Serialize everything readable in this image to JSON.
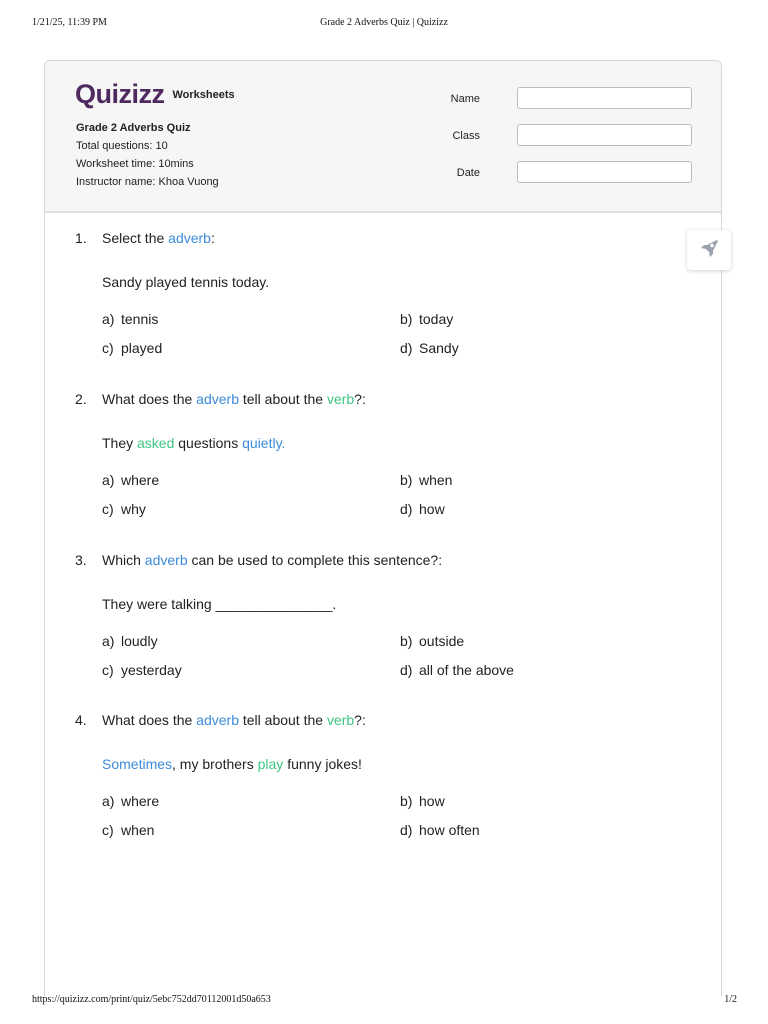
{
  "print_header": {
    "datetime": "1/21/25, 11:39 PM",
    "page_title": "Grade 2 Adverbs Quiz | Quizizz"
  },
  "print_footer": {
    "url": "https://quizizz.com/print/quiz/5ebc752dd70112001d50a653",
    "page": "1/2"
  },
  "brand": {
    "logo": "Quizizz",
    "section": "Worksheets"
  },
  "worksheet": {
    "title": "Grade 2 Adverbs Quiz",
    "total_questions": "Total questions: 10",
    "time": "Worksheet time: 10mins",
    "instructor": "Instructor name: Khoa Vuong"
  },
  "fields": [
    {
      "label": "Name",
      "value": ""
    },
    {
      "label": "Class",
      "value": ""
    },
    {
      "label": "Date",
      "value": ""
    }
  ],
  "fab": {
    "icon": "rocket-icon"
  },
  "colors": {
    "adverb": "#3d8bd9",
    "verb": "#3fc583",
    "brand": "#4e2a5f"
  },
  "questions": [
    {
      "number": "1.",
      "prompt": {
        "p1": "Select the ",
        "adverb": "adverb",
        "p2": ":"
      },
      "sentence": {
        "text": "Sandy played tennis today."
      },
      "options": [
        {
          "letter": "a)",
          "text": "tennis"
        },
        {
          "letter": "b)",
          "text": "today"
        },
        {
          "letter": "c)",
          "text": "played"
        },
        {
          "letter": "d)",
          "text": "Sandy"
        }
      ]
    },
    {
      "number": "2.",
      "prompt": {
        "p1": "What does the ",
        "adverb": "adverb",
        "p2": " tell about the ",
        "verb": "verb",
        "p3": "?:"
      },
      "sentence": {
        "s1": "They ",
        "verb": "asked",
        "s2": " questions ",
        "adverb": "quietly."
      },
      "options": [
        {
          "letter": "a)",
          "text": "where"
        },
        {
          "letter": "b)",
          "text": "when"
        },
        {
          "letter": "c)",
          "text": "why"
        },
        {
          "letter": "d)",
          "text": "how"
        }
      ]
    },
    {
      "number": "3.",
      "prompt": {
        "p1": "Which ",
        "adverb": "adverb",
        "p2": " can be used to complete this sentence?:"
      },
      "sentence": {
        "text": "They were talking _______________."
      },
      "options": [
        {
          "letter": "a)",
          "text": "loudly"
        },
        {
          "letter": "b)",
          "text": "outside"
        },
        {
          "letter": "c)",
          "text": "yesterday"
        },
        {
          "letter": "d)",
          "text": "all of the above"
        }
      ]
    },
    {
      "number": "4.",
      "prompt": {
        "p1": "What does the ",
        "adverb": "adverb",
        "p2": " tell about the ",
        "verb": "verb",
        "p3": "?:"
      },
      "sentence": {
        "adverb": "Sometimes",
        "s1": ", my brothers ",
        "verb": "play",
        "s2": " funny jokes!"
      },
      "options": [
        {
          "letter": "a)",
          "text": "where"
        },
        {
          "letter": "b)",
          "text": "how"
        },
        {
          "letter": "c)",
          "text": "when"
        },
        {
          "letter": "d)",
          "text": "how often"
        }
      ]
    }
  ]
}
